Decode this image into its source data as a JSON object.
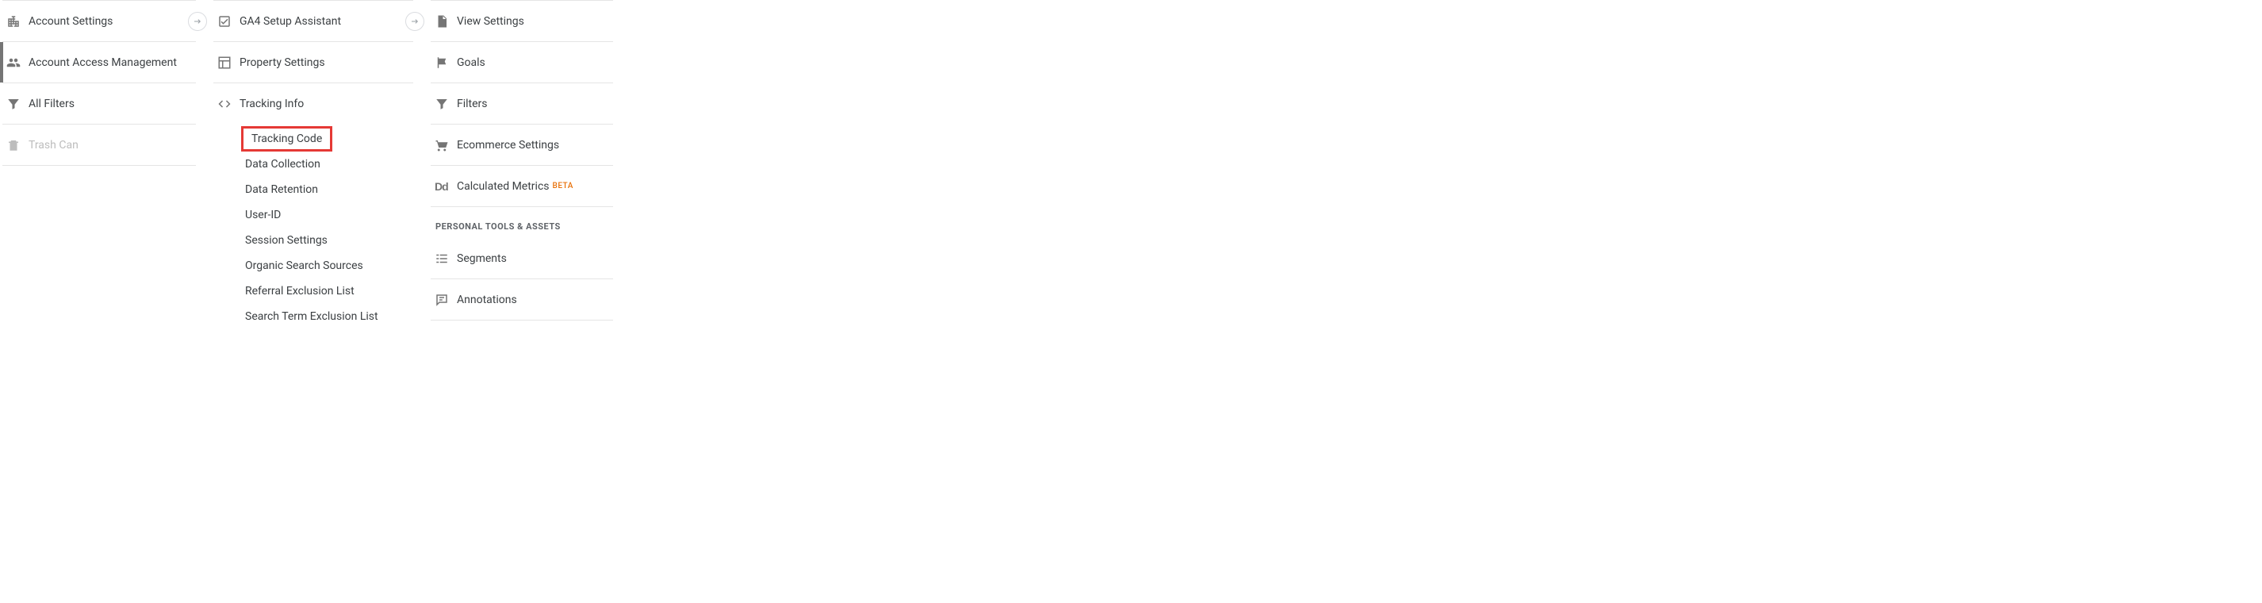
{
  "account_column": {
    "items": [
      {
        "label": "Account Settings",
        "icon": "building",
        "active_marker": false
      },
      {
        "label": "Account Access Management",
        "icon": "people",
        "active_marker": true
      },
      {
        "label": "All Filters",
        "icon": "filter",
        "active_marker": false
      },
      {
        "label": "Trash Can",
        "icon": "trash",
        "active_marker": false,
        "disabled": true
      }
    ]
  },
  "property_column": {
    "items": [
      {
        "label": "GA4 Setup Assistant",
        "icon": "checkbox"
      },
      {
        "label": "Property Settings",
        "icon": "layout"
      },
      {
        "label": "Tracking Info",
        "icon": "code",
        "expanded": true
      }
    ],
    "tracking_info_subitems": [
      {
        "label": "Tracking Code",
        "highlighted": true
      },
      {
        "label": "Data Collection"
      },
      {
        "label": "Data Retention"
      },
      {
        "label": "User-ID"
      },
      {
        "label": "Session Settings"
      },
      {
        "label": "Organic Search Sources"
      },
      {
        "label": "Referral Exclusion List"
      },
      {
        "label": "Search Term Exclusion List"
      }
    ]
  },
  "view_column": {
    "items": [
      {
        "label": "View Settings",
        "icon": "document"
      },
      {
        "label": "Goals",
        "icon": "flag"
      },
      {
        "label": "Filters",
        "icon": "filter"
      },
      {
        "label": "Ecommerce Settings",
        "icon": "cart"
      },
      {
        "label": "Calculated Metrics",
        "icon": "dd",
        "beta": "BETA"
      }
    ],
    "section_header": "Personal Tools & Assets",
    "personal_items": [
      {
        "label": "Segments",
        "icon": "segments"
      },
      {
        "label": "Annotations",
        "icon": "annotations"
      }
    ]
  }
}
